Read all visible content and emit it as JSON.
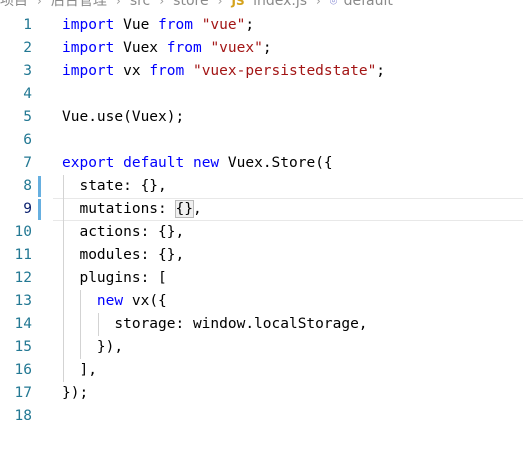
{
  "breadcrumb": {
    "items": [
      "项目",
      "后台管理",
      "src",
      "store",
      "index.js",
      "default"
    ],
    "file_icon": "js-file-icon",
    "symbol_icon": "symbol-icon"
  },
  "editor": {
    "language": "javascript",
    "current_line": 9,
    "colors": {
      "keyword": "#0000ff",
      "string": "#a31515",
      "line_number": "#237893",
      "modified_gutter": "#66afe0"
    },
    "lines": [
      {
        "n": "1",
        "tokens": [
          {
            "t": "import",
            "c": "kw"
          },
          {
            "t": " Vue ",
            "c": "plain"
          },
          {
            "t": "from",
            "c": "kw"
          },
          {
            "t": " ",
            "c": "plain"
          },
          {
            "t": "\"vue\"",
            "c": "str"
          },
          {
            "t": ";",
            "c": "plain"
          }
        ]
      },
      {
        "n": "2",
        "tokens": [
          {
            "t": "import",
            "c": "kw"
          },
          {
            "t": " Vuex ",
            "c": "plain"
          },
          {
            "t": "from",
            "c": "kw"
          },
          {
            "t": " ",
            "c": "plain"
          },
          {
            "t": "\"vuex\"",
            "c": "str"
          },
          {
            "t": ";",
            "c": "plain"
          }
        ]
      },
      {
        "n": "3",
        "tokens": [
          {
            "t": "import",
            "c": "kw"
          },
          {
            "t": " vx ",
            "c": "plain"
          },
          {
            "t": "from",
            "c": "kw"
          },
          {
            "t": " ",
            "c": "plain"
          },
          {
            "t": "\"vuex-persistedstate\"",
            "c": "str"
          },
          {
            "t": ";",
            "c": "plain"
          }
        ]
      },
      {
        "n": "4",
        "tokens": []
      },
      {
        "n": "5",
        "tokens": [
          {
            "t": "Vue.use(Vuex);",
            "c": "plain"
          }
        ]
      },
      {
        "n": "6",
        "tokens": []
      },
      {
        "n": "7",
        "tokens": [
          {
            "t": "export",
            "c": "kw"
          },
          {
            "t": " ",
            "c": "plain"
          },
          {
            "t": "default",
            "c": "kw"
          },
          {
            "t": " ",
            "c": "plain"
          },
          {
            "t": "new",
            "c": "kw"
          },
          {
            "t": " Vuex.Store({",
            "c": "plain"
          }
        ]
      },
      {
        "n": "8",
        "tokens": [
          {
            "t": "  state: {},",
            "c": "plain"
          }
        ]
      },
      {
        "n": "9",
        "tokens": [
          {
            "t": "  mutations: ",
            "c": "plain"
          },
          {
            "t": "{}",
            "c": "plain",
            "hl": true
          },
          {
            "t": ",",
            "c": "plain"
          }
        ]
      },
      {
        "n": "10",
        "tokens": [
          {
            "t": "  actions: {},",
            "c": "plain"
          }
        ]
      },
      {
        "n": "11",
        "tokens": [
          {
            "t": "  modules: {},",
            "c": "plain"
          }
        ]
      },
      {
        "n": "12",
        "tokens": [
          {
            "t": "  plugins: [",
            "c": "plain"
          }
        ]
      },
      {
        "n": "13",
        "tokens": [
          {
            "t": "    ",
            "c": "plain"
          },
          {
            "t": "new",
            "c": "kw"
          },
          {
            "t": " vx({",
            "c": "plain"
          }
        ]
      },
      {
        "n": "14",
        "tokens": [
          {
            "t": "      storage: window.localStorage,",
            "c": "plain"
          }
        ]
      },
      {
        "n": "15",
        "tokens": [
          {
            "t": "    }),",
            "c": "plain"
          }
        ]
      },
      {
        "n": "16",
        "tokens": [
          {
            "t": "  ],",
            "c": "plain"
          }
        ]
      },
      {
        "n": "17",
        "tokens": [
          {
            "t": "});",
            "c": "plain"
          }
        ]
      },
      {
        "n": "18",
        "tokens": []
      }
    ]
  }
}
